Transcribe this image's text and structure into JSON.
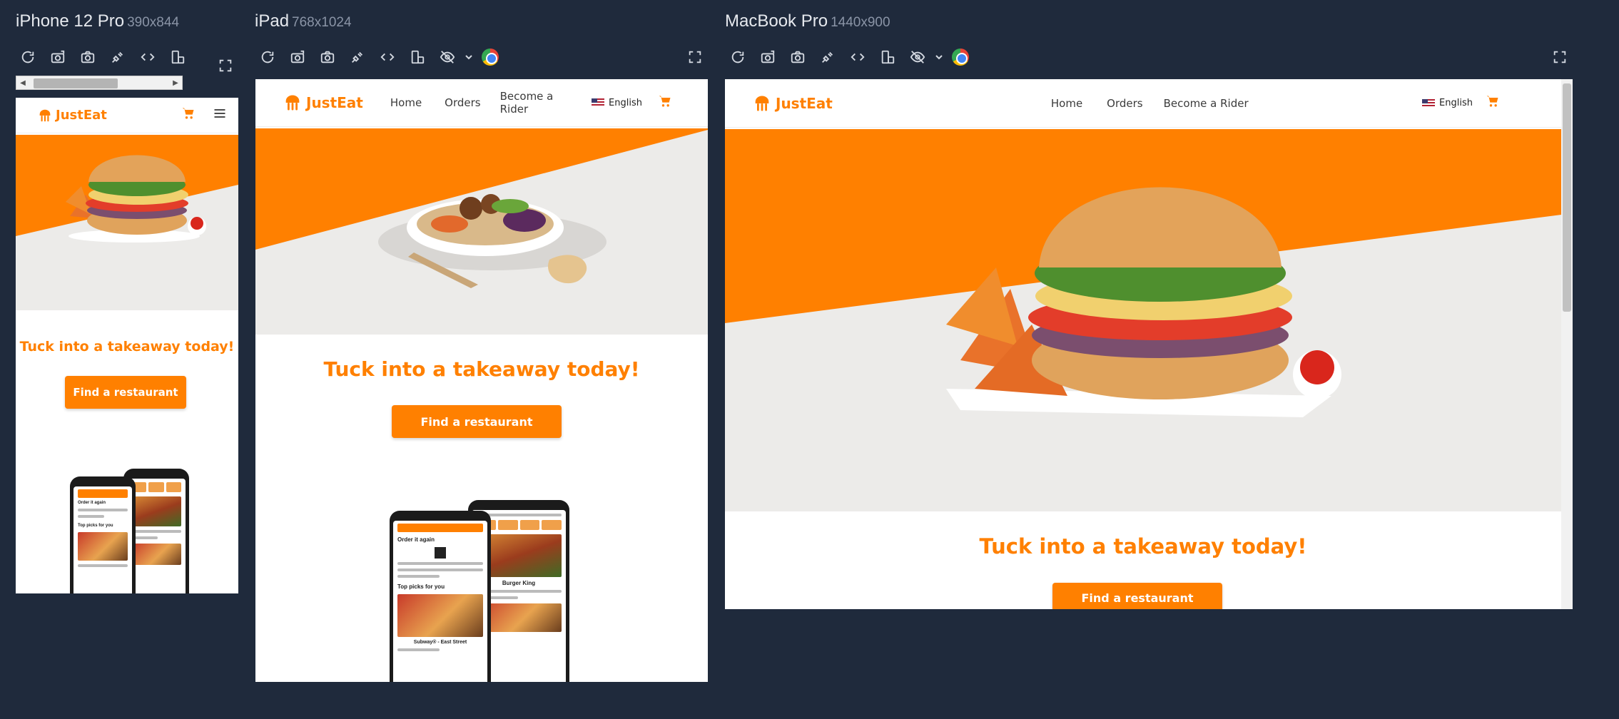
{
  "devices": {
    "iphone": {
      "name": "iPhone 12 Pro",
      "dims": "390x844"
    },
    "ipad": {
      "name": "iPad",
      "dims": "768x1024"
    },
    "macbook": {
      "name": "MacBook Pro",
      "dims": "1440x900"
    }
  },
  "toolbar_icons": [
    "refresh-icon",
    "screenshot-icon",
    "camera-icon",
    "plug-icon",
    "code-icon",
    "rotate-device-icon",
    "hide-icon",
    "chevron-down-icon",
    "chrome-icon",
    "expand-icon"
  ],
  "site": {
    "brand": "JustEat",
    "nav": {
      "home": "Home",
      "orders": "Orders",
      "rider": "Become a Rider"
    },
    "language": "English",
    "tagline": "Tuck into a takeaway today!",
    "cta": "Find a restaurant"
  },
  "app_mock": {
    "order_again": "Order it again",
    "top_picks": "Top picks for you",
    "restaurant_1": "Subway® - East Street",
    "restaurant_2": "Burger King"
  },
  "colors": {
    "brand": "#ff8000",
    "app_background": "#1f2a3c",
    "hero_background": "#ecebe9"
  }
}
